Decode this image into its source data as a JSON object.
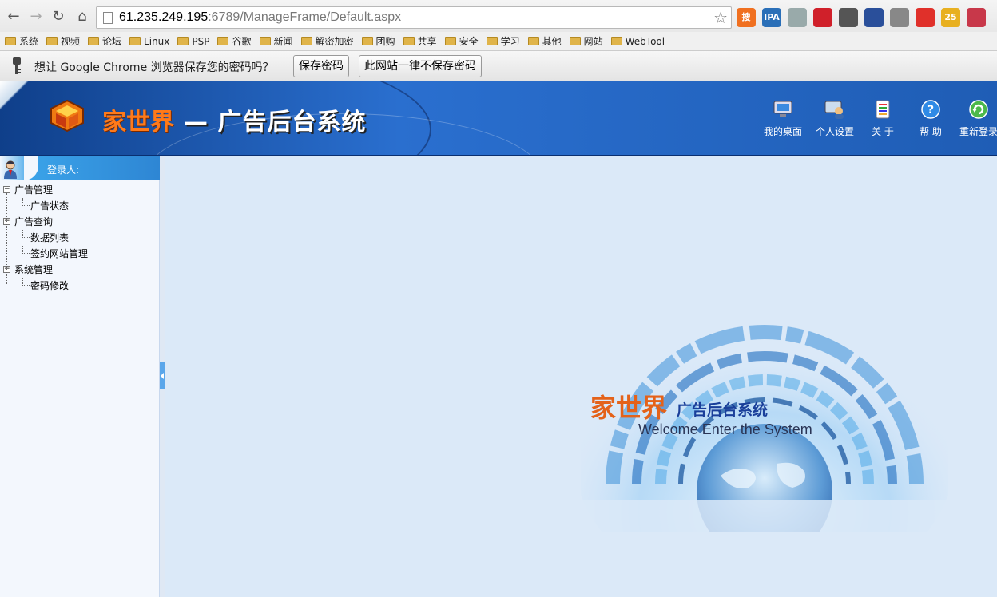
{
  "browser": {
    "url_host": "61.235.249.195",
    "url_rest": ":6789/ManageFrame/Default.aspx",
    "bookmarks": [
      "系统",
      "视频",
      "论坛",
      "Linux",
      "PSP",
      "谷歌",
      "新闻",
      "解密加密",
      "团购",
      "共享",
      "安全",
      "学习",
      "其他",
      "网站",
      "WebTool"
    ],
    "extension_icons": [
      {
        "name": "dict-icon",
        "label": "搜",
        "color": "#f07020"
      },
      {
        "name": "ipa-icon",
        "label": "IPA",
        "color": "#2a6fb8"
      },
      {
        "name": "globe-ext-icon",
        "label": "",
        "color": "#9aa"
      },
      {
        "name": "adblock-icon",
        "label": "",
        "color": "#d0202a"
      },
      {
        "name": "cards-icon",
        "label": "",
        "color": "#555"
      },
      {
        "name": "arrow-ext-icon",
        "label": "",
        "color": "#2a4f9a"
      },
      {
        "name": "gmail-icon",
        "label": "",
        "color": "#888"
      },
      {
        "name": "share-ext-icon",
        "label": "",
        "color": "#e0302a"
      },
      {
        "name": "weather-icon",
        "label": "25",
        "color": "#e8b020"
      },
      {
        "name": "weibo-icon",
        "label": "",
        "color": "#c8384a"
      }
    ]
  },
  "infobar": {
    "message": "想让 Google Chrome 浏览器保存您的密码吗？",
    "save_label": "保存密码",
    "never_label": "此网站一律不保存密码"
  },
  "header": {
    "brand": "家世界",
    "subtitle": "— 广告后台系统",
    "nav": [
      {
        "name": "desktop",
        "label": "我的桌面"
      },
      {
        "name": "settings",
        "label": "个人设置"
      },
      {
        "name": "about",
        "label": "关 于"
      },
      {
        "name": "help",
        "label": "帮 助"
      },
      {
        "name": "relogin",
        "label": "重新登录"
      }
    ]
  },
  "sidebar": {
    "login_label": "登录人:",
    "groups": [
      {
        "label": "广告管理",
        "items": [
          "广告状态"
        ]
      },
      {
        "label": "广告查询",
        "items": [
          "数据列表",
          "签约网站管理"
        ]
      },
      {
        "label": "系统管理",
        "items": [
          "密码修改"
        ]
      }
    ]
  },
  "welcome": {
    "brand": "家世界",
    "subtitle": "广告后台系统",
    "english": "Welcome Enter the System"
  },
  "colors": {
    "header_blue": "#2a6fcf",
    "brand_orange": "#ff7a1a",
    "main_bg": "#dbe9f8"
  }
}
